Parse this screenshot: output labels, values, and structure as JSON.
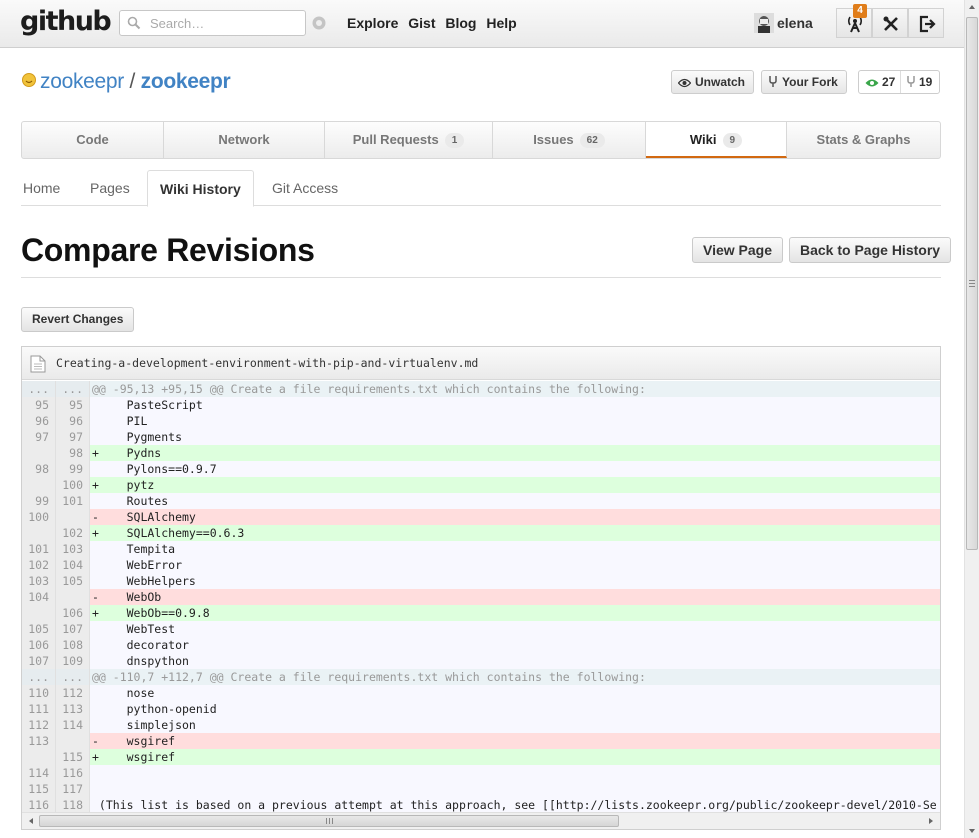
{
  "header": {
    "logo": "github",
    "search_placeholder": "Search…",
    "nav": [
      "Explore",
      "Gist",
      "Blog",
      "Help"
    ],
    "username": "elena",
    "notification_count": "4"
  },
  "repo": {
    "owner": "zookeepr",
    "separator": "/",
    "name": "zookeepr",
    "unwatch_label": "Unwatch",
    "fork_label": "Your Fork",
    "watchers": "27",
    "forks": "19"
  },
  "tabs": [
    {
      "label": "Code",
      "count": ""
    },
    {
      "label": "Network",
      "count": ""
    },
    {
      "label": "Pull Requests",
      "count": "1"
    },
    {
      "label": "Issues",
      "count": "62"
    },
    {
      "label": "Wiki",
      "count": "9"
    },
    {
      "label": "Stats & Graphs",
      "count": ""
    }
  ],
  "subtabs": [
    "Home",
    "Pages",
    "Wiki History",
    "Git Access"
  ],
  "page": {
    "title": "Compare Revisions",
    "view_page": "View Page",
    "back_history": "Back to Page History",
    "revert": "Revert Changes"
  },
  "diff": {
    "filename": "Creating-a-development-environment-with-pip-and-virtualenv.md",
    "rows": [
      {
        "type": "hunk",
        "old": "...",
        "new": "...",
        "text": "@@ -95,13 +95,15 @@ Create a file requirements.txt which contains the following:"
      },
      {
        "type": "ctx",
        "old": "95",
        "new": "95",
        "text": "     PasteScript"
      },
      {
        "type": "ctx",
        "old": "96",
        "new": "96",
        "text": "     PIL"
      },
      {
        "type": "ctx",
        "old": "97",
        "new": "97",
        "text": "     Pygments"
      },
      {
        "type": "add",
        "old": "",
        "new": "98",
        "text": "+    Pydns"
      },
      {
        "type": "ctx",
        "old": "98",
        "new": "99",
        "text": "     Pylons==0.9.7"
      },
      {
        "type": "add",
        "old": "",
        "new": "100",
        "text": "+    pytz"
      },
      {
        "type": "ctx",
        "old": "99",
        "new": "101",
        "text": "     Routes"
      },
      {
        "type": "del",
        "old": "100",
        "new": "",
        "text": "-    SQLAlchemy"
      },
      {
        "type": "add",
        "old": "",
        "new": "102",
        "text": "+    SQLAlchemy==0.6.3"
      },
      {
        "type": "ctx",
        "old": "101",
        "new": "103",
        "text": "     Tempita"
      },
      {
        "type": "ctx",
        "old": "102",
        "new": "104",
        "text": "     WebError"
      },
      {
        "type": "ctx",
        "old": "103",
        "new": "105",
        "text": "     WebHelpers"
      },
      {
        "type": "del",
        "old": "104",
        "new": "",
        "text": "-    WebOb"
      },
      {
        "type": "add",
        "old": "",
        "new": "106",
        "text": "+    WebOb==0.9.8"
      },
      {
        "type": "ctx",
        "old": "105",
        "new": "107",
        "text": "     WebTest"
      },
      {
        "type": "ctx",
        "old": "106",
        "new": "108",
        "text": "     decorator"
      },
      {
        "type": "ctx",
        "old": "107",
        "new": "109",
        "text": "     dnspython"
      },
      {
        "type": "hunk",
        "old": "...",
        "new": "...",
        "text": "@@ -110,7 +112,7 @@ Create a file requirements.txt which contains the following:"
      },
      {
        "type": "ctx",
        "old": "110",
        "new": "112",
        "text": "     nose"
      },
      {
        "type": "ctx",
        "old": "111",
        "new": "113",
        "text": "     python-openid"
      },
      {
        "type": "ctx",
        "old": "112",
        "new": "114",
        "text": "     simplejson"
      },
      {
        "type": "del",
        "old": "113",
        "new": "",
        "text": "-    wsgiref"
      },
      {
        "type": "add",
        "old": "",
        "new": "115",
        "text": "+    wsgiref"
      },
      {
        "type": "ctx",
        "old": "114",
        "new": "116",
        "text": ""
      },
      {
        "type": "ctx",
        "old": "115",
        "new": "117",
        "text": ""
      },
      {
        "type": "ctx",
        "old": "116",
        "new": "118",
        "text": " (This list is based on a previous attempt at this approach, see [[http://lists.zookeepr.org/public/zookeepr-devel/2010-Se"
      }
    ]
  },
  "colors": {
    "link": "#4183c4",
    "active_tab_underline": "#d26911",
    "add_bg": "#ddffdd",
    "del_bg": "#ffdddd",
    "badge": "#e07d1a"
  }
}
